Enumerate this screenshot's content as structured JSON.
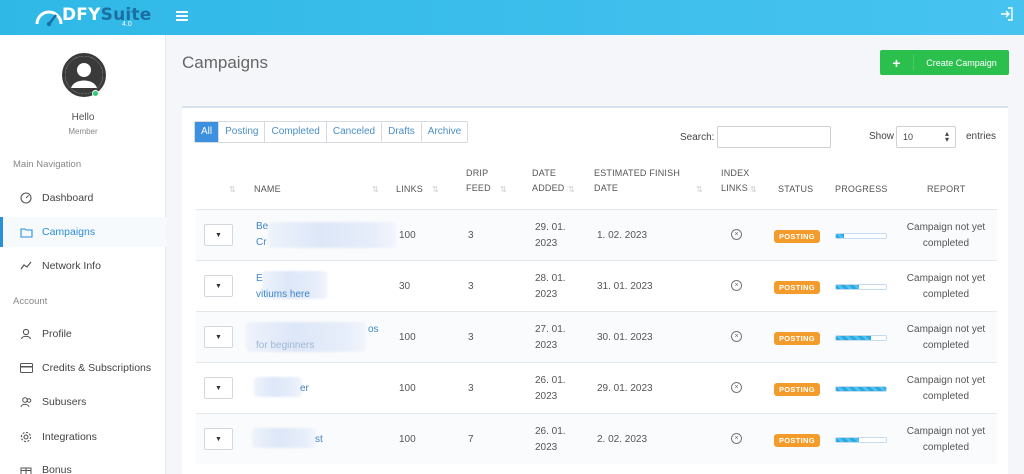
{
  "header": {
    "logo_main": "DFY",
    "logo_suite": "Suite",
    "logo_version": "4.0",
    "menu_icon": "hamburger-icon",
    "logout_icon": "logout-icon"
  },
  "sidebar": {
    "greeting": "Hello",
    "role": "Member",
    "main_nav_title": "Main Navigation",
    "account_title": "Account",
    "items": [
      {
        "label": "Dashboard",
        "icon": "gauge-icon"
      },
      {
        "label": "Campaigns",
        "icon": "folder-icon",
        "active": true
      },
      {
        "label": "Network Info",
        "icon": "chart-line-icon"
      },
      {
        "label": "Profile",
        "icon": "user-icon"
      },
      {
        "label": "Credits & Subscriptions",
        "icon": "credit-card-icon"
      },
      {
        "label": "Subusers",
        "icon": "users-icon"
      },
      {
        "label": "Integrations",
        "icon": "gear-icon"
      },
      {
        "label": "Bonus",
        "icon": "gift-icon"
      }
    ]
  },
  "main": {
    "title": "Campaigns",
    "create_button": "Create Campaign",
    "filters": [
      "All",
      "Posting",
      "Completed",
      "Canceled",
      "Drafts",
      "Archive"
    ],
    "search_label": "Search:",
    "search_value": "",
    "show_label": "Show",
    "show_value": "10",
    "entries_label": "entries"
  },
  "table": {
    "headers": {
      "name": "NAME",
      "links": "LINKS",
      "drip_1": "DRIP",
      "drip_2": "FEED",
      "date_1": "DATE",
      "date_2": "ADDED",
      "est_1": "ESTIMATED FINISH",
      "est_2": "DATE",
      "index_1": "INDEX",
      "index_2": "LINKS",
      "status": "STATUS",
      "progress": "PROGRESS",
      "report": "REPORT"
    },
    "rows": [
      {
        "name_1": "Be",
        "name_2": "Cr",
        "links": "100",
        "drip": "3",
        "date_1": "29. 01.",
        "date_2": "2023",
        "finish": "1. 02. 2023",
        "status": "POSTING",
        "progress": 0.15,
        "report_1": "Campaign not yet",
        "report_2": "completed"
      },
      {
        "name_1": "E",
        "name_2": "vitiums here",
        "links": "30",
        "drip": "3",
        "date_1": "28. 01.",
        "date_2": "2023",
        "finish": "31. 01. 2023",
        "status": "POSTING",
        "progress": 0.45,
        "report_1": "Campaign not yet",
        "report_2": "completed"
      },
      {
        "name_1": "os",
        "name_2": "for beginners",
        "links": "100",
        "drip": "3",
        "date_1": "27. 01.",
        "date_2": "2023",
        "finish": "30. 01. 2023",
        "status": "POSTING",
        "progress": 0.7,
        "report_1": "Campaign not yet",
        "report_2": "completed"
      },
      {
        "name_1": "er",
        "name_2": "",
        "links": "100",
        "drip": "3",
        "date_1": "26. 01.",
        "date_2": "2023",
        "finish": "29. 01. 2023",
        "status": "POSTING",
        "progress": 1.0,
        "report_1": "Campaign not yet",
        "report_2": "completed"
      },
      {
        "name_1": "st",
        "name_2": "",
        "links": "100",
        "drip": "7",
        "date_1": "26. 01.",
        "date_2": "2023",
        "finish": "2. 02. 2023",
        "status": "POSTING",
        "progress": 0.45,
        "report_1": "Campaign not yet",
        "report_2": "completed"
      }
    ]
  }
}
